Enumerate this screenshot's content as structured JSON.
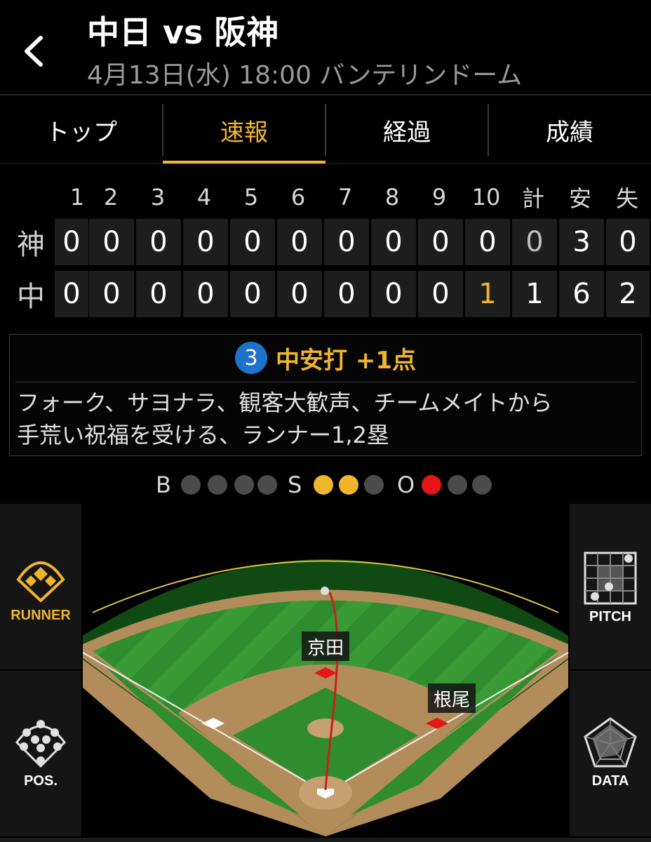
{
  "header": {
    "title": "中日 vs 阪神",
    "subtitle": "4月13日(水) 18:00 バンテリンドーム",
    "back_icon": "chevron-left-icon"
  },
  "tabs": [
    {
      "label": "トップ",
      "active": false
    },
    {
      "label": "速報",
      "active": true
    },
    {
      "label": "経過",
      "active": false
    },
    {
      "label": "成績",
      "active": false
    }
  ],
  "scoreboard": {
    "columns": [
      "1",
      "2",
      "3",
      "4",
      "5",
      "6",
      "7",
      "8",
      "9",
      "10",
      "計",
      "安",
      "失"
    ],
    "rows": [
      {
        "team": "神",
        "cells": [
          "0",
          "0",
          "0",
          "0",
          "0",
          "0",
          "0",
          "0",
          "0",
          "0",
          "0",
          "3",
          "0"
        ]
      },
      {
        "team": "中",
        "cells": [
          "0",
          "0",
          "0",
          "0",
          "0",
          "0",
          "0",
          "0",
          "0",
          "1",
          "1",
          "6",
          "2"
        ]
      }
    ]
  },
  "play": {
    "number": "3",
    "result": "中安打 +1点",
    "description_line1": "フォーク、サヨナラ、観客大歓声、チームメイトから",
    "description_line2": "手荒い祝福を受ける、ランナー1,2塁"
  },
  "count": {
    "ball_label": "B",
    "strike_label": "S",
    "out_label": "O",
    "balls": 0,
    "strikes": 2,
    "outs": 1
  },
  "side_buttons": {
    "runner": "RUNNER",
    "pitch": "PITCH",
    "pos": "POS.",
    "data": "DATA"
  },
  "field": {
    "runner_second": "京田",
    "runner_first": "根尾"
  },
  "colors": {
    "accent": "#f1b52c",
    "badge": "#1d73c9",
    "out": "#e41616",
    "grass": "#2e8b2e",
    "dirt": "#b38c5c"
  }
}
